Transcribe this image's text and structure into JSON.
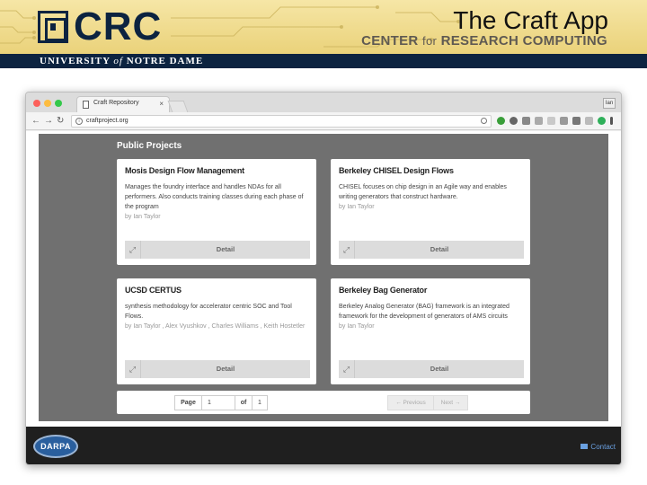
{
  "slide": {
    "title": "The Craft App",
    "org_short": "CRC",
    "org_prefix": "CENTER",
    "org_for": "for",
    "org_rest": "RESEARCH COMPUTING",
    "univ_start": "UNIVERSITY",
    "univ_of": "of",
    "univ_end": "NOTRE DAME"
  },
  "browser": {
    "tab_title": "Craft Repository",
    "tab_close": "×",
    "url": "craftproject.org",
    "user": "Ian"
  },
  "page": {
    "section_title": "Public Projects",
    "projects": [
      {
        "title": "Mosis Design Flow Management",
        "desc": "Manages the foundry interface and handles NDAs for all performers. Also conducts training classes during each phase of the program",
        "author": "by Ian Taylor",
        "action": "Detail"
      },
      {
        "title": "Berkeley CHISEL Design Flows",
        "desc": "CHISEL focuses on chip design in an Agile way and enables writing generators that construct hardware.",
        "author": "by Ian Taylor",
        "action": "Detail"
      },
      {
        "title": "UCSD CERTUS",
        "desc": "synthesis methodology for accelerator centric SOC and Tool Flows.",
        "author": "by Ian Taylor , Alex Vyushkov , Charles Williams , Keith Hostetler",
        "action": "Detail"
      },
      {
        "title": "Berkeley Bag Generator",
        "desc": "Berkeley Analog Generator (BAG) framework is an integrated framework for the development of generators of AMS circuits",
        "author": "by Ian Taylor",
        "action": "Detail"
      }
    ],
    "pagination": {
      "page_label": "Page",
      "page_value": "1",
      "of_label": "of",
      "total": "1",
      "prev_label": "← Previous",
      "next_label": "Next →"
    },
    "footer": {
      "logo": "DARPA",
      "contact": "Contact"
    }
  }
}
